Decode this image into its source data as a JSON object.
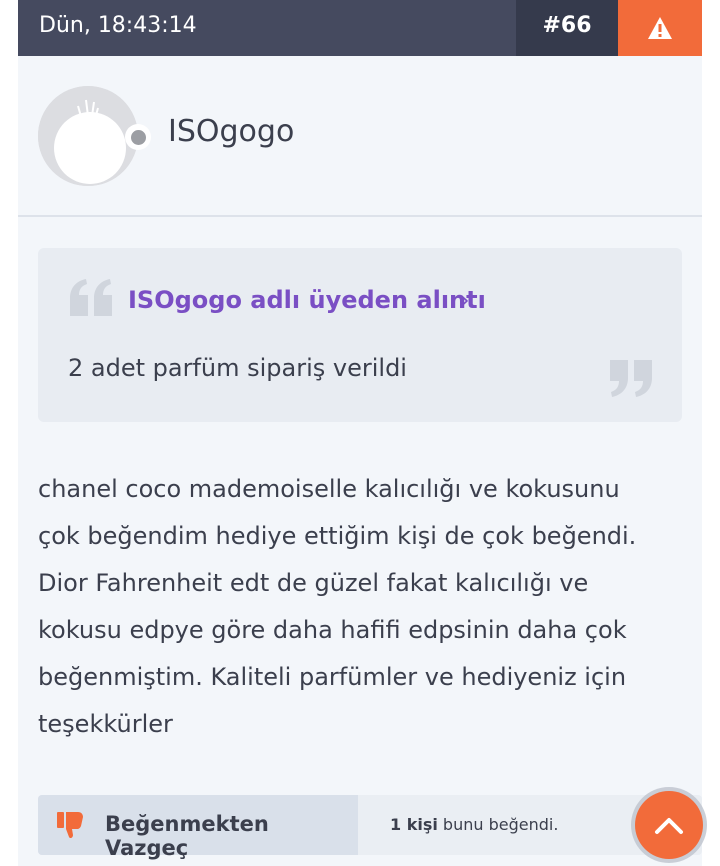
{
  "header": {
    "timestamp": "Dün, 18:43:14",
    "post_number": "#66",
    "report_icon": "warning-icon"
  },
  "user": {
    "username": "ISOgogo",
    "status": "offline"
  },
  "quote": {
    "author_text": "ISOgogo adlı üyeden alıntı",
    "chevron": "›",
    "text": "2 adet parfüm sipariş verildi"
  },
  "post": {
    "lines": [
      "chanel coco mademoiselle kalıcılığı ve kokusunu",
      "çok beğendim hediye ettiğim kişi de çok beğendi.",
      "Dior Fahrenheit edt de güzel fakat kalıcılığı ve",
      "kokusu edpye göre daha hafifi edpsinin daha çok",
      "beğenmiştim. Kaliteli parfümler ve hediyeniz için",
      "teşekkürler"
    ]
  },
  "like": {
    "button_label": "Beğenmekten Vazgeç",
    "count_bold": "1 kişi",
    "count_rest": " bunu beğendi."
  },
  "colors": {
    "header_bg": "#454a5f",
    "accent_orange": "#f26b3a",
    "quote_author": "#7a4fc4"
  }
}
